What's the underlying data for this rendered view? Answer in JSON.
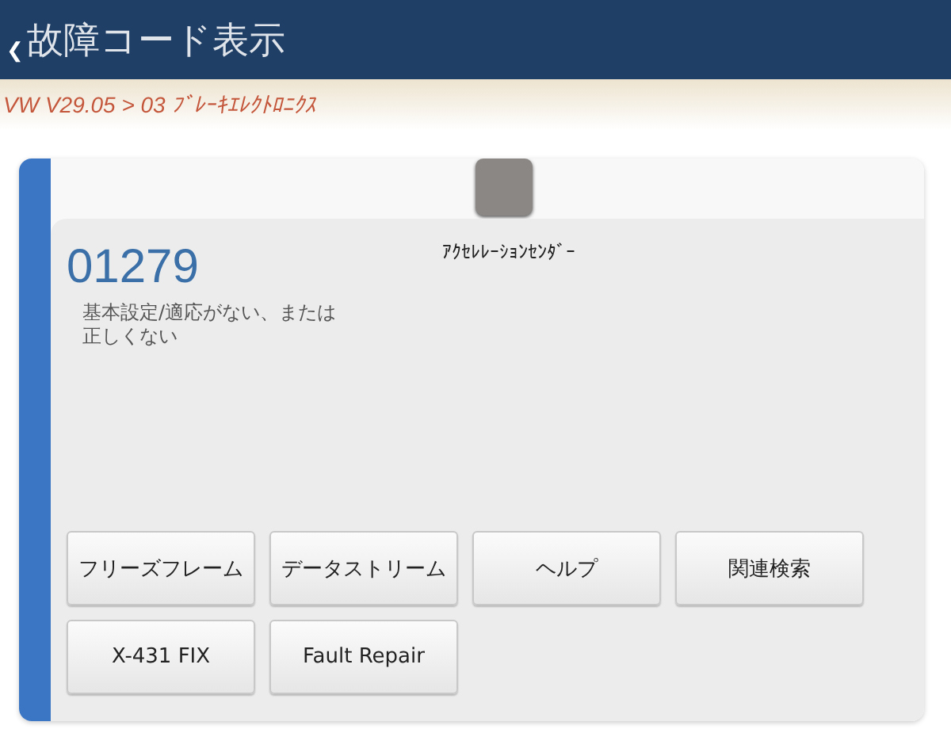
{
  "header": {
    "title": "故障コード表示",
    "back": "❮"
  },
  "breadcrumb": "VW V29.05 > 03 ﾌﾞﾚｰｷｴﾚｸﾄﾛﾆｸｽ",
  "fault": {
    "code": "01279",
    "component": "ｱｸｾﾚﾚｰｼｮﾝｾﾝﾀﾞｰ",
    "description": [
      "基本設定/適応がない、または",
      "正しくない"
    ]
  },
  "buttons": [
    "フリーズフレーム",
    "データストリーム",
    "ヘルプ",
    "関連検索",
    "X-431 FIX",
    "Fault Repair"
  ]
}
